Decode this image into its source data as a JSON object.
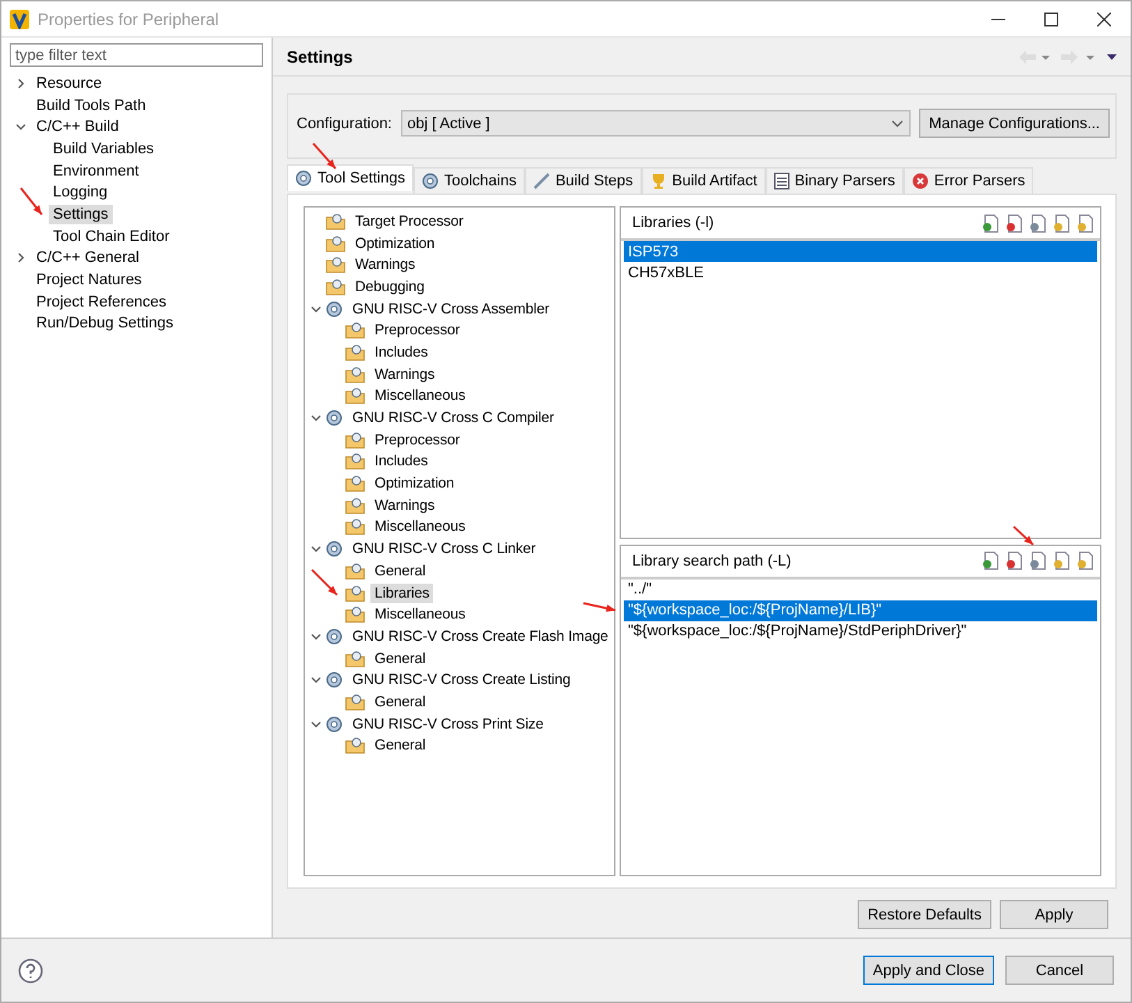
{
  "window": {
    "title": "Properties for Peripheral"
  },
  "filter": {
    "placeholder": "type filter text"
  },
  "nav": [
    {
      "label": "Resource",
      "expanded": false,
      "selected": false
    },
    {
      "label": "Build Tools Path",
      "selected": false
    },
    {
      "label": "C/C++ Build",
      "expanded": true,
      "selected": false,
      "children": [
        {
          "label": "Build Variables",
          "selected": false
        },
        {
          "label": "Environment",
          "selected": false
        },
        {
          "label": "Logging",
          "selected": false
        },
        {
          "label": "Settings",
          "selected": true
        },
        {
          "label": "Tool Chain Editor",
          "selected": false
        }
      ]
    },
    {
      "label": "C/C++ General",
      "expanded": false,
      "selected": false
    },
    {
      "label": "Project Natures",
      "selected": false
    },
    {
      "label": "Project References",
      "selected": false
    },
    {
      "label": "Run/Debug Settings",
      "selected": false
    }
  ],
  "page": {
    "title": "Settings"
  },
  "configuration": {
    "label": "Configuration:",
    "value": "obj  [ Active ]",
    "button": "Manage Configurations..."
  },
  "tabs": [
    {
      "label": "Tool Settings",
      "kind": "gear",
      "selected": true
    },
    {
      "label": "Toolchains",
      "kind": "gear",
      "selected": false
    },
    {
      "label": "Build Steps",
      "kind": "wand",
      "selected": false
    },
    {
      "label": "Build Artifact",
      "kind": "trophy",
      "selected": false
    },
    {
      "label": "Binary Parsers",
      "kind": "binary",
      "selected": false
    },
    {
      "label": "Error Parsers",
      "kind": "error",
      "selected": false
    }
  ],
  "tool_tree": [
    {
      "label": "Target Processor",
      "kind": "option",
      "selected": false
    },
    {
      "label": "Optimization",
      "kind": "option",
      "selected": false
    },
    {
      "label": "Warnings",
      "kind": "option",
      "selected": false
    },
    {
      "label": "Debugging",
      "kind": "option",
      "selected": false
    },
    {
      "label": "GNU RISC-V Cross Assembler",
      "kind": "tool",
      "expanded": true,
      "selected": false,
      "children": [
        {
          "label": "Preprocessor",
          "kind": "option",
          "selected": false
        },
        {
          "label": "Includes",
          "kind": "option",
          "selected": false
        },
        {
          "label": "Warnings",
          "kind": "option",
          "selected": false
        },
        {
          "label": "Miscellaneous",
          "kind": "option",
          "selected": false
        }
      ]
    },
    {
      "label": "GNU RISC-V Cross C Compiler",
      "kind": "tool",
      "expanded": true,
      "selected": false,
      "children": [
        {
          "label": "Preprocessor",
          "kind": "option",
          "selected": false
        },
        {
          "label": "Includes",
          "kind": "option",
          "selected": false
        },
        {
          "label": "Optimization",
          "kind": "option",
          "selected": false
        },
        {
          "label": "Warnings",
          "kind": "option",
          "selected": false
        },
        {
          "label": "Miscellaneous",
          "kind": "option",
          "selected": false
        }
      ]
    },
    {
      "label": "GNU RISC-V Cross C Linker",
      "kind": "tool",
      "expanded": true,
      "selected": false,
      "children": [
        {
          "label": "General",
          "kind": "option",
          "selected": false
        },
        {
          "label": "Libraries",
          "kind": "option",
          "selected": true
        },
        {
          "label": "Miscellaneous",
          "kind": "option",
          "selected": false
        }
      ]
    },
    {
      "label": "GNU RISC-V Cross Create Flash Image",
      "kind": "tool",
      "expanded": true,
      "selected": false,
      "children": [
        {
          "label": "General",
          "kind": "option",
          "selected": false
        }
      ]
    },
    {
      "label": "GNU RISC-V Cross Create Listing",
      "kind": "tool",
      "expanded": true,
      "selected": false,
      "children": [
        {
          "label": "General",
          "kind": "option",
          "selected": false
        }
      ]
    },
    {
      "label": "GNU RISC-V Cross Print Size",
      "kind": "tool",
      "expanded": true,
      "selected": false,
      "children": [
        {
          "label": "General",
          "kind": "option",
          "selected": false
        }
      ]
    }
  ],
  "lists": [
    {
      "title": "Libraries (-l)",
      "items": [
        {
          "text": "ISP573",
          "selected": true
        },
        {
          "text": "CH57xBLE",
          "selected": false
        }
      ]
    },
    {
      "title": "Library search path (-L)",
      "items": [
        {
          "text": "\"../\"",
          "selected": false
        },
        {
          "text": "\"${workspace_loc:/${ProjName}/LIB}\"",
          "selected": true
        },
        {
          "text": "\"${workspace_loc:/${ProjName}/StdPeriphDriver}\"",
          "selected": false
        }
      ]
    }
  ],
  "page_buttons": [
    "Restore Defaults",
    "Apply"
  ],
  "dialog_buttons": [
    {
      "label": "Apply and Close",
      "default": true
    },
    {
      "label": "Cancel",
      "default": false
    }
  ]
}
